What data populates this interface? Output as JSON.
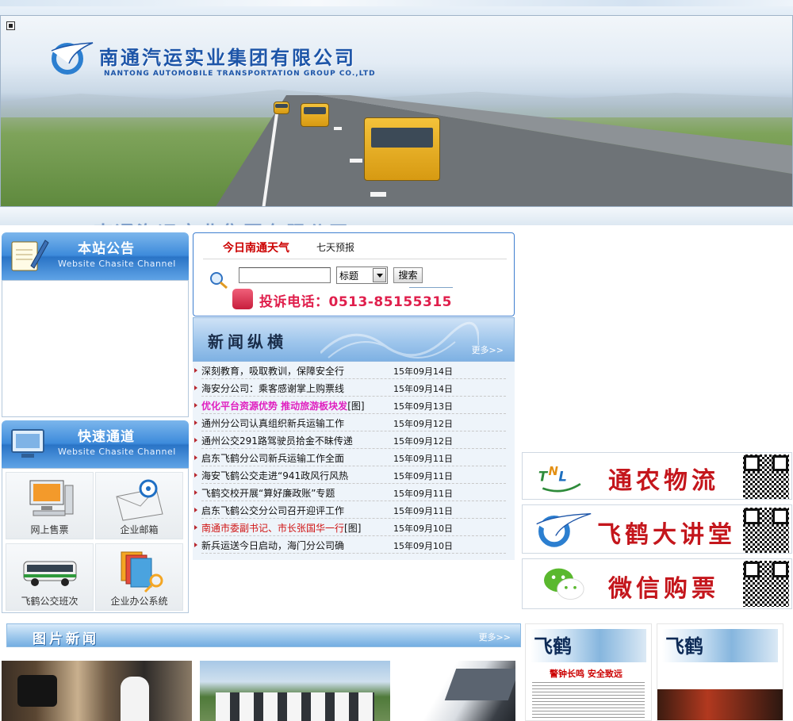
{
  "header": {
    "title_cn": "南通汽运实业集团有限公司",
    "title_en": "NANTONG AUTOMOBILE TRANSPORTATION GROUP CO.,LTD"
  },
  "announce": {
    "title": "本站公告",
    "subtitle": "Website Chasite Channel"
  },
  "quick": {
    "title": "快速通道",
    "subtitle": "Website Chasite Channel",
    "tiles": [
      {
        "label": "网上售票",
        "icon": "computer-icon"
      },
      {
        "label": "企业邮箱",
        "icon": "envelope-icon"
      },
      {
        "label": "飞鹤公交班次",
        "icon": "bus-icon"
      },
      {
        "label": "企业办公系统",
        "icon": "office-system-icon"
      }
    ]
  },
  "weather": {
    "today": "今日南通天气",
    "forecast": "七天预报"
  },
  "search": {
    "input_value": "",
    "select_value": "标题",
    "button": "搜索"
  },
  "hotline": "投诉电话：0513-85155315",
  "news": {
    "title": "新闻纵横",
    "more": "更多>>",
    "items": [
      {
        "title": "深刻教育，吸取教训，保障安全行",
        "date": "15年09月14日",
        "style": "normal",
        "tag": ""
      },
      {
        "title": "海安分公司：乘客感谢掌上购票线",
        "date": "15年09月14日",
        "style": "normal",
        "tag": ""
      },
      {
        "title": "优化平台资源优势 推动旅游板块发",
        "date": "15年09月13日",
        "style": "pink",
        "tag": "[图]"
      },
      {
        "title": "通州分公司认真组织新兵运输工作",
        "date": "15年09月12日",
        "style": "normal",
        "tag": ""
      },
      {
        "title": "通州公交291路驾驶员拾金不昧传递",
        "date": "15年09月12日",
        "style": "normal",
        "tag": ""
      },
      {
        "title": "启东飞鹤分公司新兵运输工作全面",
        "date": "15年09月11日",
        "style": "normal",
        "tag": ""
      },
      {
        "title": "海安飞鹤公交走进“941政风行风热",
        "date": "15年09月11日",
        "style": "normal",
        "tag": ""
      },
      {
        "title": "飞鹤交校开展“算好廉政账”专题",
        "date": "15年09月11日",
        "style": "normal",
        "tag": ""
      },
      {
        "title": "启东飞鹤公交分公司召开迎评工作",
        "date": "15年09月11日",
        "style": "normal",
        "tag": ""
      },
      {
        "title": "南通市委副书记、市长张国华一行",
        "date": "15年09月10日",
        "style": "red",
        "tag": "[图]"
      },
      {
        "title": "新兵运送今日启动，海门分公司确",
        "date": "15年09月10日",
        "style": "normal",
        "tag": ""
      }
    ]
  },
  "right_banners": [
    {
      "text": "通农物流",
      "color": "#c4161c",
      "logo": "TNL"
    },
    {
      "text": "飞鹤大讲堂",
      "color": "#c4161c",
      "logo": ""
    },
    {
      "text": "微信购票",
      "color": "#c4161c",
      "logo": ""
    }
  ],
  "pic_news": {
    "title": "图片新闻",
    "more": "更多>>"
  },
  "newspapers": [
    {
      "logo": "飞鹤",
      "headline": "警钟长鸣 安全致远"
    },
    {
      "logo": "飞鹤",
      "headline": ""
    }
  ]
}
